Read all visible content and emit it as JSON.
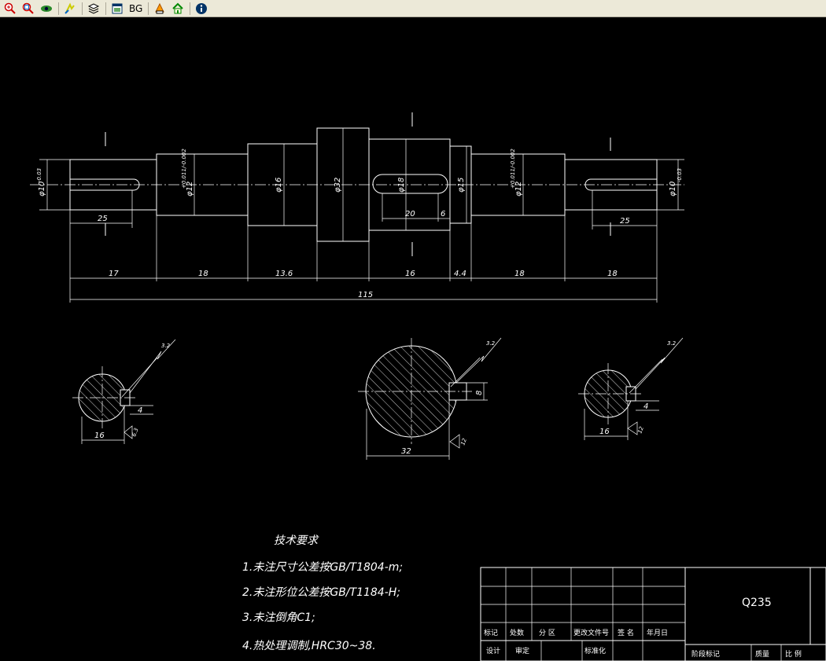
{
  "toolbar": {
    "buttons": [
      {
        "name": "zoom-in-icon"
      },
      {
        "name": "zoom-window-icon"
      },
      {
        "name": "pan-eye-icon"
      },
      {
        "name": "redraw-icon"
      },
      {
        "name": "layers-icon"
      },
      {
        "name": "window-icon"
      },
      {
        "name": "bg-button",
        "label": "BG"
      },
      {
        "name": "print-icon"
      },
      {
        "name": "home-icon"
      },
      {
        "name": "info-icon"
      }
    ],
    "bg_label": "BG"
  },
  "drawing": {
    "dims": {
      "d10_left": "φ10",
      "d10_left_tol": "-0.03",
      "d12_left": "φ12",
      "d12_left_tol": "+0.011/-0.002",
      "d16": "φ16",
      "d32": "φ32",
      "d18": "φ18",
      "d15": "φ15",
      "d12_right": "φ12",
      "d12_right_tol": "+0.011/-0.002",
      "d10_right": "φ10",
      "d10_right_tol": "-0.03",
      "key_left_len": "25",
      "key_right_len": "25",
      "key_mid_len": "20",
      "key_mid_off": "6",
      "seg1": "17",
      "seg2": "18",
      "seg3": "13.6",
      "seg4": "16",
      "seg5": "4.4",
      "seg6": "18",
      "seg7": "18",
      "total": "115"
    },
    "sections": {
      "left": {
        "rough": "3.2",
        "rough2": "6.3",
        "w": "4",
        "h": "16"
      },
      "mid": {
        "rough": "3.2",
        "rough2": "12",
        "w": "8",
        "h": "32"
      },
      "right": {
        "rough": "3.2",
        "rough2": "12",
        "w": "4",
        "h": "16"
      }
    },
    "notes": {
      "title": "技术要求",
      "items": [
        "1.未注尺寸公差按GB/T1804-m;",
        "2.未注形位公差按GB/T1184-H;",
        "3.未注倒角C1;",
        "4.热处理调制,HRC30~38."
      ]
    },
    "title_block": {
      "material": "Q235",
      "row1": [
        "标记",
        "处数",
        "分 区",
        "更改文件号",
        "签 名",
        "年月日"
      ],
      "row2": [
        "设计",
        "审定",
        "标准化"
      ],
      "right_row": [
        "阶段标记",
        "质量",
        "比 例"
      ]
    }
  }
}
